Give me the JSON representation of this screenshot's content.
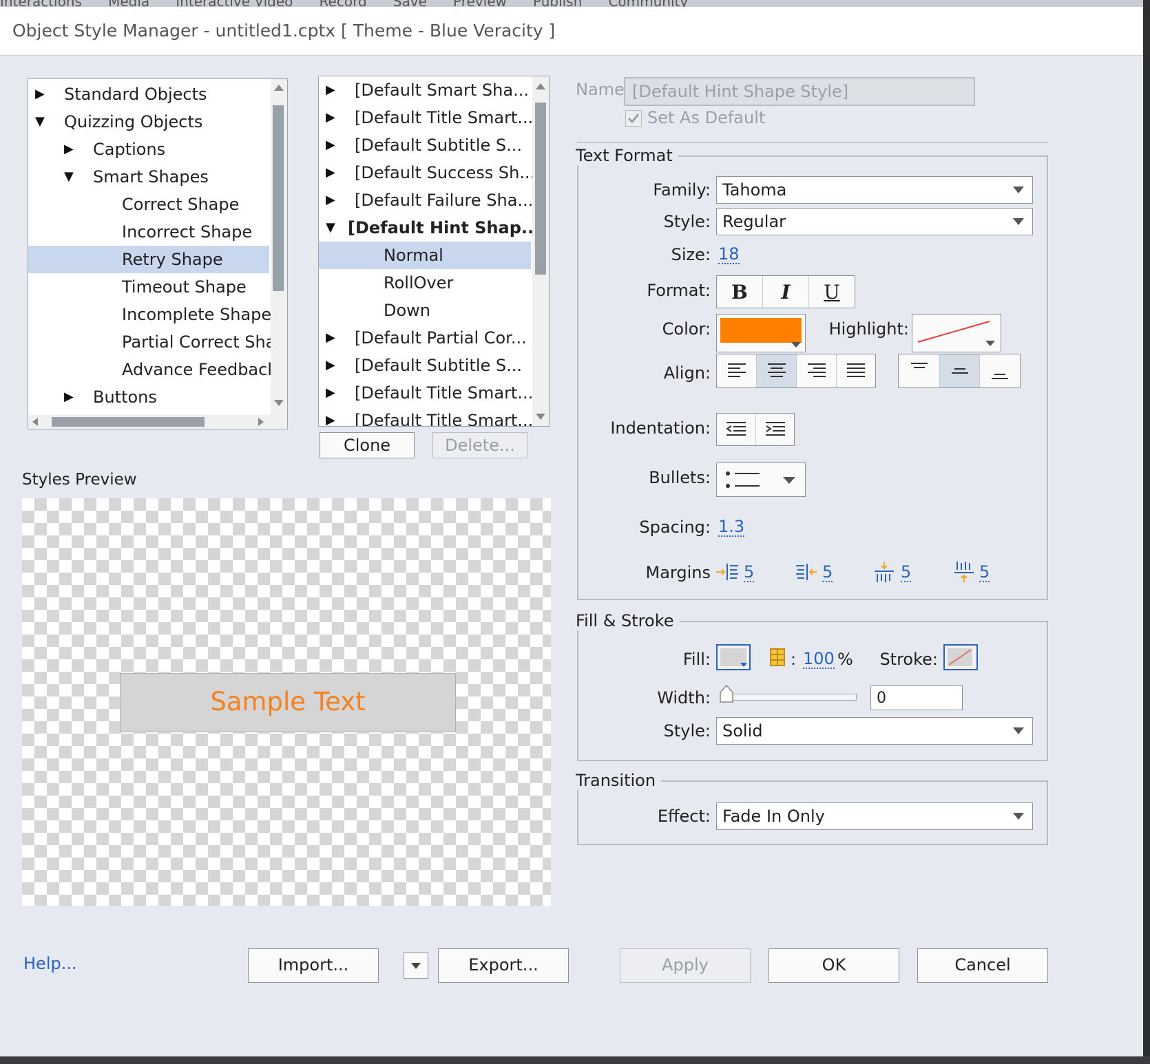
{
  "window": {
    "title": "Object Style Manager - untitled1.cptx [ Theme - Blue Veracity ]"
  },
  "background_toolbar": {
    "text": "Interactions      Media      Interactive Video      Record      Save      Preview      Publish      Community"
  },
  "left_tree": {
    "items": [
      {
        "label": "Standard Objects",
        "expander": "collapsed"
      },
      {
        "label": "Quizzing Objects",
        "expander": "expanded"
      },
      {
        "label": "Captions",
        "expander": "collapsed"
      },
      {
        "label": "Smart Shapes",
        "expander": "expanded"
      },
      {
        "label": "Correct Shape",
        "expander": "none"
      },
      {
        "label": "Incorrect Shape",
        "expander": "none"
      },
      {
        "label": "Retry Shape",
        "expander": "none",
        "selected": true
      },
      {
        "label": "Timeout Shape",
        "expander": "none"
      },
      {
        "label": "Incomplete Shape",
        "expander": "none"
      },
      {
        "label": "Partial Correct Shap",
        "expander": "none"
      },
      {
        "label": "Advance Feedback S",
        "expander": "none"
      },
      {
        "label": "Buttons",
        "expander": "collapsed"
      }
    ]
  },
  "style_list": {
    "items": [
      {
        "label": "[Default Smart Sha...",
        "expander": "collapsed"
      },
      {
        "label": "[Default Title Smart...",
        "expander": "collapsed"
      },
      {
        "label": "[Default Subtitle S...",
        "expander": "collapsed"
      },
      {
        "label": "[Default Success Sh...",
        "expander": "collapsed"
      },
      {
        "label": "[Default Failure Sha...",
        "expander": "collapsed"
      },
      {
        "label": "[Default Hint Shap...",
        "expander": "expanded",
        "bold": true
      },
      {
        "label": "Normal",
        "expander": "none",
        "selected": true
      },
      {
        "label": "RollOver",
        "expander": "none"
      },
      {
        "label": "Down",
        "expander": "none"
      },
      {
        "label": "[Default Partial Cor...",
        "expander": "collapsed"
      },
      {
        "label": "[Default Subtitle S...",
        "expander": "collapsed"
      },
      {
        "label": "[Default Title Smart...",
        "expander": "collapsed"
      },
      {
        "label": "[Default Title Smart...",
        "expander": "collapsed"
      }
    ],
    "clone_label": "Clone",
    "delete_label": "Delete..."
  },
  "preview": {
    "heading": "Styles Preview",
    "sample_text": "Sample Text",
    "sample_color": "#f58220"
  },
  "properties": {
    "name_label": "Name",
    "name_value": "[Default Hint Shape Style]",
    "set_default_label": "Set As Default",
    "text_format": {
      "group_label": "Text Format",
      "family_label": "Family:",
      "family_value": "Tahoma",
      "style_label": "Style:",
      "style_value": "Regular",
      "size_label": "Size:",
      "size_value": "18",
      "format_label": "Format:",
      "bold": "B",
      "italic": "I",
      "underline": "U",
      "color_label": "Color:",
      "color_value": "#ff8000",
      "highlight_label": "Highlight:",
      "align_label": "Align:",
      "indentation_label": "Indentation:",
      "bullets_label": "Bullets:",
      "spacing_label": "Spacing:",
      "spacing_value": "1.3",
      "margins_label": "Margins",
      "margin_left": "5",
      "margin_right": "5",
      "margin_top": "5",
      "margin_bottom": "5"
    },
    "fill_stroke": {
      "group_label": "Fill & Stroke",
      "fill_label": "Fill:",
      "opacity_value": "100",
      "percent": "%",
      "stroke_label": "Stroke:",
      "width_label": "Width:",
      "width_value": "0",
      "style_label": "Style:",
      "style_value": "Solid"
    },
    "transition": {
      "group_label": "Transition",
      "effect_label": "Effect:",
      "effect_value": "Fade In Only"
    }
  },
  "footer": {
    "help": "Help...",
    "import": "Import...",
    "export": "Export...",
    "apply": "Apply",
    "ok": "OK",
    "cancel": "Cancel"
  }
}
